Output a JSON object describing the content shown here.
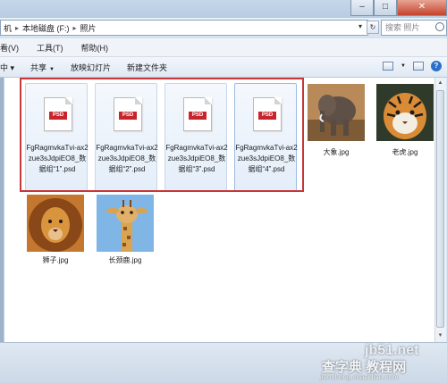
{
  "addressbar": {
    "crumbs": [
      "机",
      "本地磁盘 (F:)",
      "照片"
    ],
    "search_placeholder": "搜索 照片"
  },
  "menubar": {
    "items": [
      "看(V)",
      "工具(T)",
      "帮助(H)"
    ]
  },
  "commandbar": {
    "items": [
      "中 ▾",
      "共享",
      "放映幻灯片",
      "新建文件夹"
    ]
  },
  "psd_files": [
    {
      "label": "FgRagmvkaTvi-ax2zue3sJdpiEO8_数据组“1”.psd",
      "badge": "PSD"
    },
    {
      "label": "FgRagmvkaTvi-ax2zue3sJdpiEO8_数据组“2”.psd",
      "badge": "PSD"
    },
    {
      "label": "FgRagmvkaTvi-ax2zue3sJdpiEO8_数据组“3”.psd",
      "badge": "PSD"
    },
    {
      "label": "FgRagmvkaTvi-ax2zue3sJdpiEO8_数据组“4”.psd",
      "badge": "PSD"
    }
  ],
  "images": [
    {
      "label": "大象.jpg"
    },
    {
      "label": "老虎.jpg"
    },
    {
      "label": "狮子.jpg"
    },
    {
      "label": "长颈鹿.jpg"
    }
  ],
  "watermark": {
    "line1": "jb51.net",
    "line2": "查字典 教程网",
    "line3": "jiaocheng.chazidian.com"
  },
  "colors": {
    "highlight": "#c7373a",
    "psd_badge": "#c8242c"
  }
}
